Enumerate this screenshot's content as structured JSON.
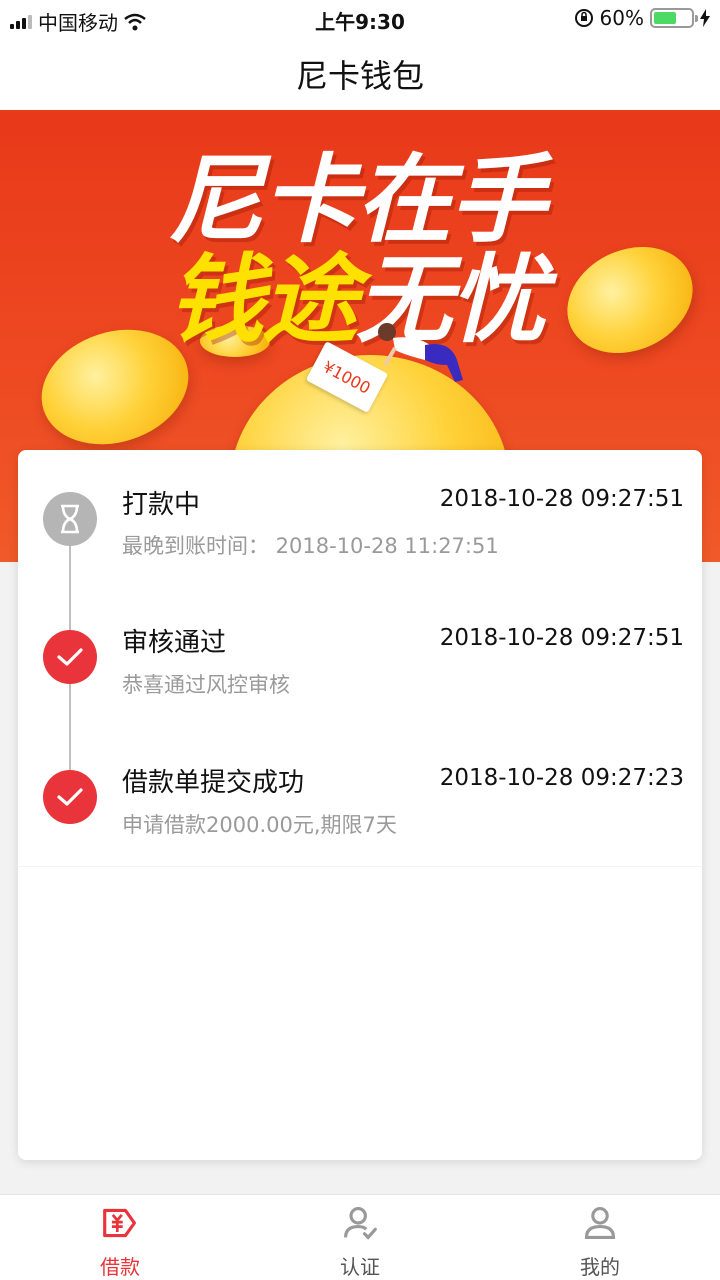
{
  "status_bar": {
    "carrier": "中国移动",
    "time": "上午9:30",
    "battery_percent": "60%",
    "battery_level": 0.6,
    "icons": [
      "signal-icon",
      "wifi-icon",
      "orientation-lock-icon",
      "battery-icon",
      "charging-icon"
    ]
  },
  "nav": {
    "title": "尼卡钱包"
  },
  "banner": {
    "line1": "尼卡在手",
    "line2_yellow": "钱途",
    "line2_white": "无忧",
    "note_label": "¥1000"
  },
  "steps": [
    {
      "title": "打款中",
      "time": "2018-10-28 09:27:51",
      "subtitle": "最晚到账时间： 2018-10-28 11:27:51",
      "status": "pending",
      "icon": "hourglass-icon"
    },
    {
      "title": "审核通过",
      "time": "2018-10-28 09:27:51",
      "subtitle": "恭喜通过风控审核",
      "status": "done",
      "icon": "check-icon"
    },
    {
      "title": "借款单提交成功",
      "time": "2018-10-28 09:27:23",
      "subtitle": "申请借款2000.00元,期限7天",
      "status": "done",
      "icon": "check-icon"
    }
  ],
  "tabs": [
    {
      "label": "借款",
      "icon": "loan-icon",
      "active": true
    },
    {
      "label": "认证",
      "icon": "verify-user-icon",
      "active": false
    },
    {
      "label": "我的",
      "icon": "profile-icon",
      "active": false
    }
  ],
  "colors": {
    "accent": "#e8343a",
    "banner": "#e8391a",
    "pending": "#b5b5b5"
  }
}
